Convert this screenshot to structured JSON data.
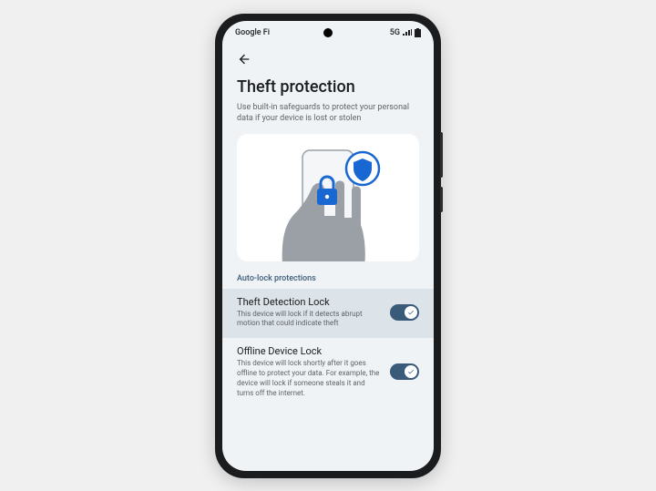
{
  "status_bar": {
    "carrier": "Google Fi",
    "network": "5G"
  },
  "page": {
    "title": "Theft protection",
    "subtitle": "Use built-in safeguards to protect your personal data if your device is lost or stolen"
  },
  "section": {
    "label": "Auto-lock protections"
  },
  "toggles": [
    {
      "title": "Theft Detection Lock",
      "description": "This device will lock if it detects abrupt motion that could indicate theft",
      "enabled": true
    },
    {
      "title": "Offline Device Lock",
      "description": "This device will lock shortly after it goes offline to protect your data. For example, the device will lock if someone steals it and turns off the internet.",
      "enabled": true
    }
  ],
  "colors": {
    "accent": "#3a5a7a",
    "icon_blue": "#1967d2"
  }
}
